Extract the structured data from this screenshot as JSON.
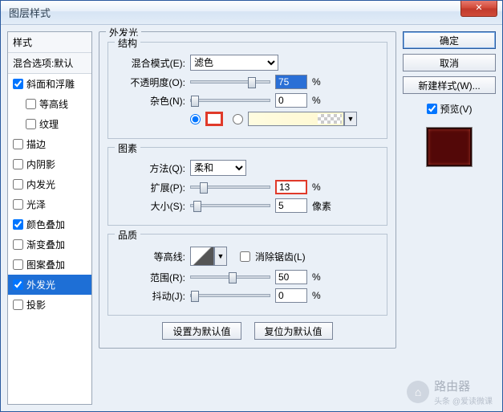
{
  "window": {
    "title": "图层样式"
  },
  "sidebar": {
    "header": "样式",
    "subheader": "混合选项:默认",
    "items": [
      {
        "label": "斜面和浮雕",
        "checked": true
      },
      {
        "label": "等高线",
        "checked": false,
        "indent": true
      },
      {
        "label": "纹理",
        "checked": false,
        "indent": true
      },
      {
        "label": "描边",
        "checked": false
      },
      {
        "label": "内阴影",
        "checked": false
      },
      {
        "label": "内发光",
        "checked": false
      },
      {
        "label": "光泽",
        "checked": false
      },
      {
        "label": "颜色叠加",
        "checked": true
      },
      {
        "label": "渐变叠加",
        "checked": false
      },
      {
        "label": "图案叠加",
        "checked": false
      },
      {
        "label": "外发光",
        "checked": true,
        "selected": true
      },
      {
        "label": "投影",
        "checked": false
      }
    ]
  },
  "main": {
    "title": "外发光",
    "structure": {
      "title": "结构",
      "blend_mode_label": "混合模式(E):",
      "blend_mode_value": "滤色",
      "opacity_label": "不透明度(O):",
      "opacity_value": "75",
      "opacity_unit": "%",
      "noise_label": "杂色(N):",
      "noise_value": "0",
      "noise_unit": "%"
    },
    "element": {
      "title": "图素",
      "method_label": "方法(Q):",
      "method_value": "柔和",
      "spread_label": "扩展(P):",
      "spread_value": "13",
      "spread_unit": "%",
      "size_label": "大小(S):",
      "size_value": "5",
      "size_unit": "像素"
    },
    "quality": {
      "title": "品质",
      "contour_label": "等高线:",
      "antialias_label": "消除锯齿(L)",
      "range_label": "范围(R):",
      "range_value": "50",
      "range_unit": "%",
      "jitter_label": "抖动(J):",
      "jitter_value": "0",
      "jitter_unit": "%"
    },
    "buttons": {
      "set_default": "设置为默认值",
      "reset_default": "复位为默认值"
    }
  },
  "right": {
    "ok": "确定",
    "cancel": "取消",
    "new_style": "新建样式(W)...",
    "preview": "预览(V)"
  },
  "watermark": {
    "brand": "路由器",
    "credit": "头条 @爱读微课"
  }
}
